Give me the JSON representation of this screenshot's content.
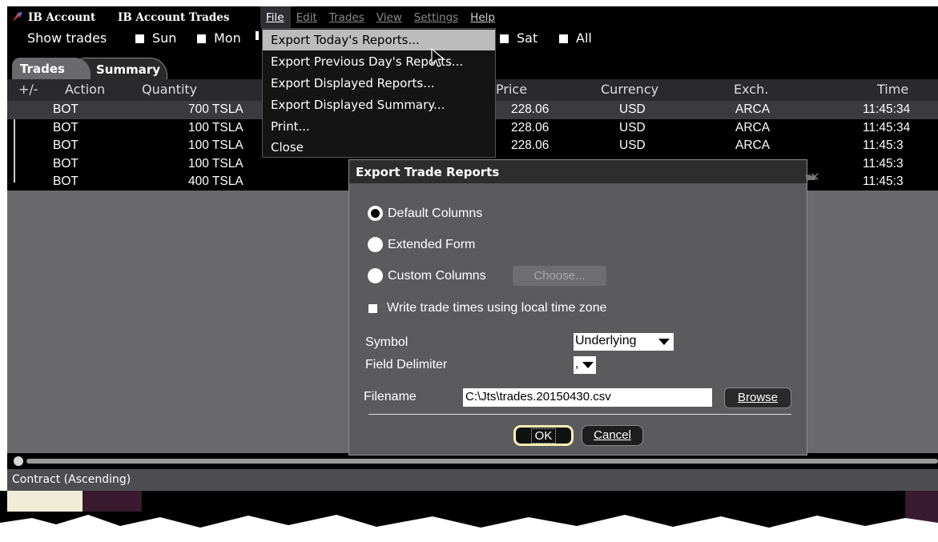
{
  "window": {
    "account_label": "IB Account",
    "title": "IB Account Trades"
  },
  "menu": {
    "file": "File",
    "edit": "Edit",
    "trades": "Trades",
    "view": "View",
    "settings": "Settings",
    "help": "Help"
  },
  "show_trades": {
    "label": "Show trades",
    "days": [
      "Sun",
      "Mon",
      "Sat",
      "All"
    ]
  },
  "tabs": {
    "trades": "Trades",
    "summary": "Summary"
  },
  "columns": {
    "expand": "+/-",
    "action": "Action",
    "quantity": "Quantity",
    "price": "Price",
    "currency": "Currency",
    "exch": "Exch.",
    "time": "Time"
  },
  "rows": [
    {
      "action": "BOT",
      "qty": "700 TSLA",
      "price": "228.06",
      "currency": "USD",
      "exch": "ARCA",
      "time": "11:45:34"
    },
    {
      "action": "BOT",
      "qty": "100 TSLA",
      "price": "228.06",
      "currency": "USD",
      "exch": "ARCA",
      "time": "11:45:34"
    },
    {
      "action": "BOT",
      "qty": "100 TSLA",
      "price": "228.06",
      "currency": "USD",
      "exch": "ARCA",
      "time": "11:45:3"
    },
    {
      "action": "BOT",
      "qty": "100 TSLA",
      "price": "",
      "currency": "",
      "exch": "",
      "time": "11:45:3"
    },
    {
      "action": "BOT",
      "qty": "400 TSLA",
      "price": "",
      "currency": "",
      "exch": "",
      "time": "11:45:3"
    }
  ],
  "file_menu": {
    "export_today": "Export Today's Reports...",
    "export_previous": "Export Previous Day's Reports...",
    "export_displayed": "Export Displayed Reports...",
    "export_summary": "Export Displayed Summary...",
    "print": "Print...",
    "close": "Close"
  },
  "dialog": {
    "title": "Export Trade Reports",
    "default_columns": "Default Columns",
    "extended_form": "Extended Form",
    "custom_columns": "Custom Columns",
    "choose": "Choose...",
    "local_time": "Write trade times using local time zone",
    "symbol_label": "Symbol",
    "symbol_value": "Underlying",
    "delimiter_label": "Field Delimiter",
    "delimiter_value": ",",
    "filename_label": "Filename",
    "filename_value": "C:\\Jts\\trades.20150430.csv",
    "browse": "Browse",
    "ok": "OK",
    "cancel": "Cancel"
  },
  "status": {
    "sort": "Contract (Ascending)"
  },
  "colors": {
    "menu_highlight": "#bcbcbc",
    "grid_bg": "#6a6a6d",
    "dialog_bg": "#5b5b5e",
    "ok_focus": "#f5f0b0"
  }
}
